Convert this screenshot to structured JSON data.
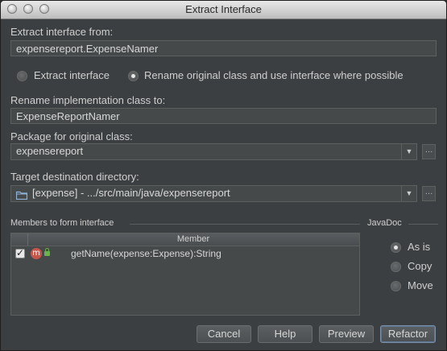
{
  "window": {
    "title": "Extract Interface"
  },
  "extract_from": {
    "label": "Extract interface from:",
    "value": "expensereport.ExpenseNamer"
  },
  "mode": {
    "extract_label": "Extract interface",
    "rename_label": "Rename original class and use interface where possible",
    "selected": "rename"
  },
  "rename_impl": {
    "label": "Rename implementation class to:",
    "value": "ExpenseReportNamer"
  },
  "package": {
    "label": "Package for original class:",
    "value": "expensereport"
  },
  "target_dir": {
    "label": "Target destination directory:",
    "value": "[expense] - .../src/main/java/expensereport"
  },
  "members": {
    "group_label": "Members to form interface",
    "column_header": "Member",
    "rows": [
      {
        "checked": true,
        "icon": "method-icon",
        "icon_letter": "m",
        "text": "getName(expense:Expense):String"
      }
    ]
  },
  "javadoc": {
    "group_label": "JavaDoc",
    "options": [
      "As is",
      "Copy",
      "Move"
    ],
    "selected": "As is"
  },
  "buttons": {
    "cancel": "Cancel",
    "help": "Help",
    "preview": "Preview",
    "refactor": "Refactor"
  },
  "icons": {
    "folder": "folder-icon",
    "dots": "…"
  }
}
